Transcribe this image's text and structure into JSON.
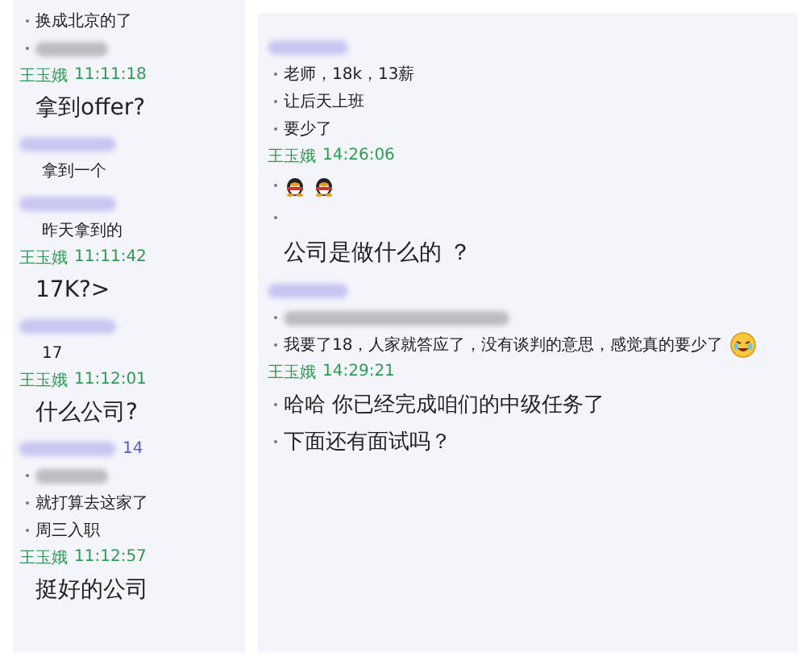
{
  "panels": [
    {
      "messages": [
        {
          "kind": "line",
          "bullet": true,
          "text": "换成北京的了"
        },
        {
          "kind": "redacted-line",
          "bullet": true
        },
        {
          "kind": "sender",
          "name": "王玉娥",
          "time": "11:11:18"
        },
        {
          "kind": "big-line",
          "bullet": false,
          "text": "拿到offer?"
        },
        {
          "kind": "redacted"
        },
        {
          "kind": "line",
          "bullet": false,
          "text": "拿到一个"
        },
        {
          "kind": "redacted"
        },
        {
          "kind": "line",
          "bullet": false,
          "text": "昨天拿到的"
        },
        {
          "kind": "sender",
          "name": "王玉娥",
          "time": "11:11:42"
        },
        {
          "kind": "big-line",
          "bullet": false,
          "text": "17K?>"
        },
        {
          "kind": "redacted"
        },
        {
          "kind": "line",
          "bullet": false,
          "text": "17"
        },
        {
          "kind": "sender",
          "name": "王玉娥",
          "time": "11:12:01"
        },
        {
          "kind": "big-line",
          "bullet": false,
          "text": "什么公司?"
        },
        {
          "kind": "redacted",
          "suffix": "14"
        },
        {
          "kind": "redacted-line",
          "bullet": true
        },
        {
          "kind": "line",
          "bullet": true,
          "text": "就打算去这家了"
        },
        {
          "kind": "line",
          "bullet": true,
          "text": "周三入职"
        },
        {
          "kind": "sender",
          "name": "王玉娥",
          "time": "11:12:57"
        },
        {
          "kind": "big-line",
          "bullet": false,
          "text": "挺好的公司"
        }
      ]
    },
    {
      "messages": [
        {
          "kind": "redacted"
        },
        {
          "kind": "line",
          "bullet": true,
          "text": "老师，18k，13薪"
        },
        {
          "kind": "line",
          "bullet": true,
          "text": "让后天上班"
        },
        {
          "kind": "line",
          "bullet": true,
          "text": "要少了"
        },
        {
          "kind": "sender",
          "name": "王玉娥",
          "time": "14:26:06"
        },
        {
          "kind": "emoji",
          "bullet": true
        },
        {
          "kind": "empty-line",
          "bullet": true
        },
        {
          "kind": "big-line",
          "bullet": false,
          "text": "公司是做什么的 ？"
        },
        {
          "kind": "redacted"
        },
        {
          "kind": "redacted-line",
          "bullet": true
        },
        {
          "kind": "line",
          "bullet": true,
          "text": "我要了18，人家就答应了，没有谈判的意思，感觉真的要少了",
          "face": true
        },
        {
          "kind": "sender",
          "name": "王玉娥",
          "time": "14:29:21"
        },
        {
          "kind": "big-line",
          "bullet": true,
          "text": "哈哈  你已经完成咱们的中级任务了"
        },
        {
          "kind": "big-line",
          "bullet": true,
          "text": "下面还有面试吗？"
        }
      ]
    }
  ]
}
